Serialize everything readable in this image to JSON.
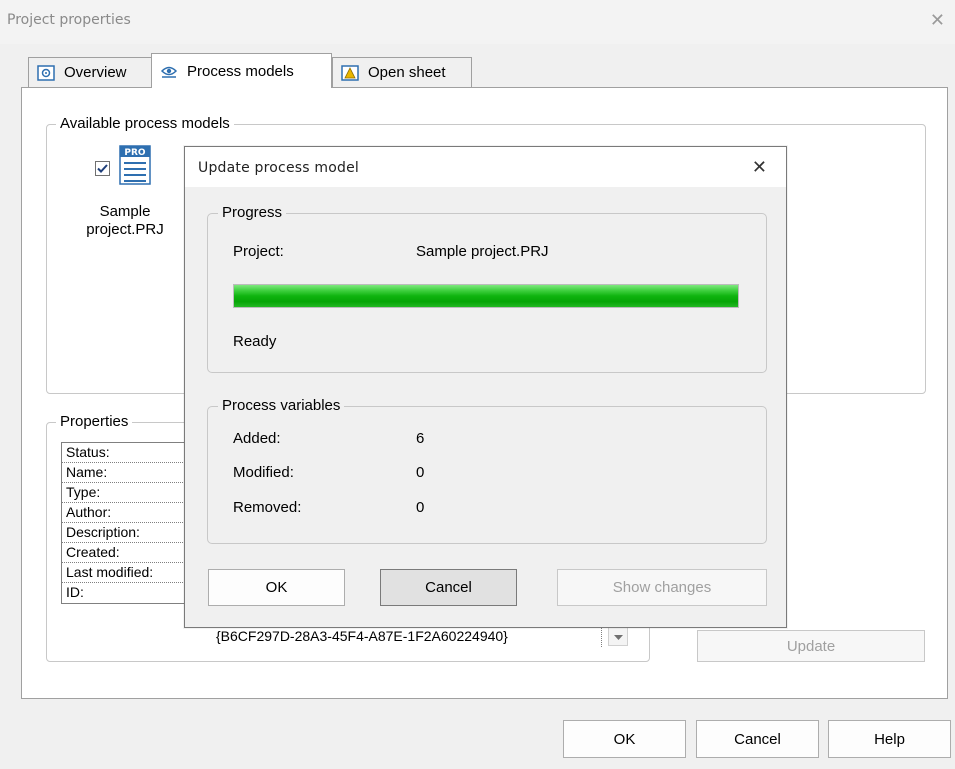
{
  "window": {
    "title": "Project properties",
    "close_glyph": "✕"
  },
  "tabs": [
    {
      "label": "Overview",
      "icon": "gear-icon"
    },
    {
      "label": "Process models",
      "icon": "eye-icon"
    },
    {
      "label": "Open sheet",
      "icon": "warning-icon"
    }
  ],
  "available": {
    "legend": "Available process models",
    "item": {
      "icon_text": "PRO",
      "label_line1": "Sample",
      "label_line2": "project.PRJ",
      "checked": true
    }
  },
  "properties": {
    "legend": "Properties",
    "rows": [
      "Status:",
      "Name:",
      "Type:",
      "Author:",
      "Description:",
      "Created:",
      "Last modified:",
      "ID:"
    ],
    "id_value": "{B6CF297D-28A3-45F4-A87E-1F2A60224940}"
  },
  "update_button": "Update",
  "footer": {
    "ok": "OK",
    "cancel": "Cancel",
    "help": "Help"
  },
  "modal": {
    "title": "Update process model",
    "close_glyph": "✕",
    "progress": {
      "legend": "Progress",
      "project_label": "Project:",
      "project_value": "Sample project.PRJ",
      "percent": 100,
      "status": "Ready"
    },
    "variables": {
      "legend": "Process variables",
      "added_label": "Added:",
      "added_value": "6",
      "modified_label": "Modified:",
      "modified_value": "0",
      "removed_label": "Removed:",
      "removed_value": "0"
    },
    "buttons": {
      "ok": "OK",
      "cancel": "Cancel",
      "show_changes": "Show changes"
    }
  },
  "colors": {
    "progress_green": "#0fb40f",
    "icon_blue": "#2e6fb0"
  }
}
